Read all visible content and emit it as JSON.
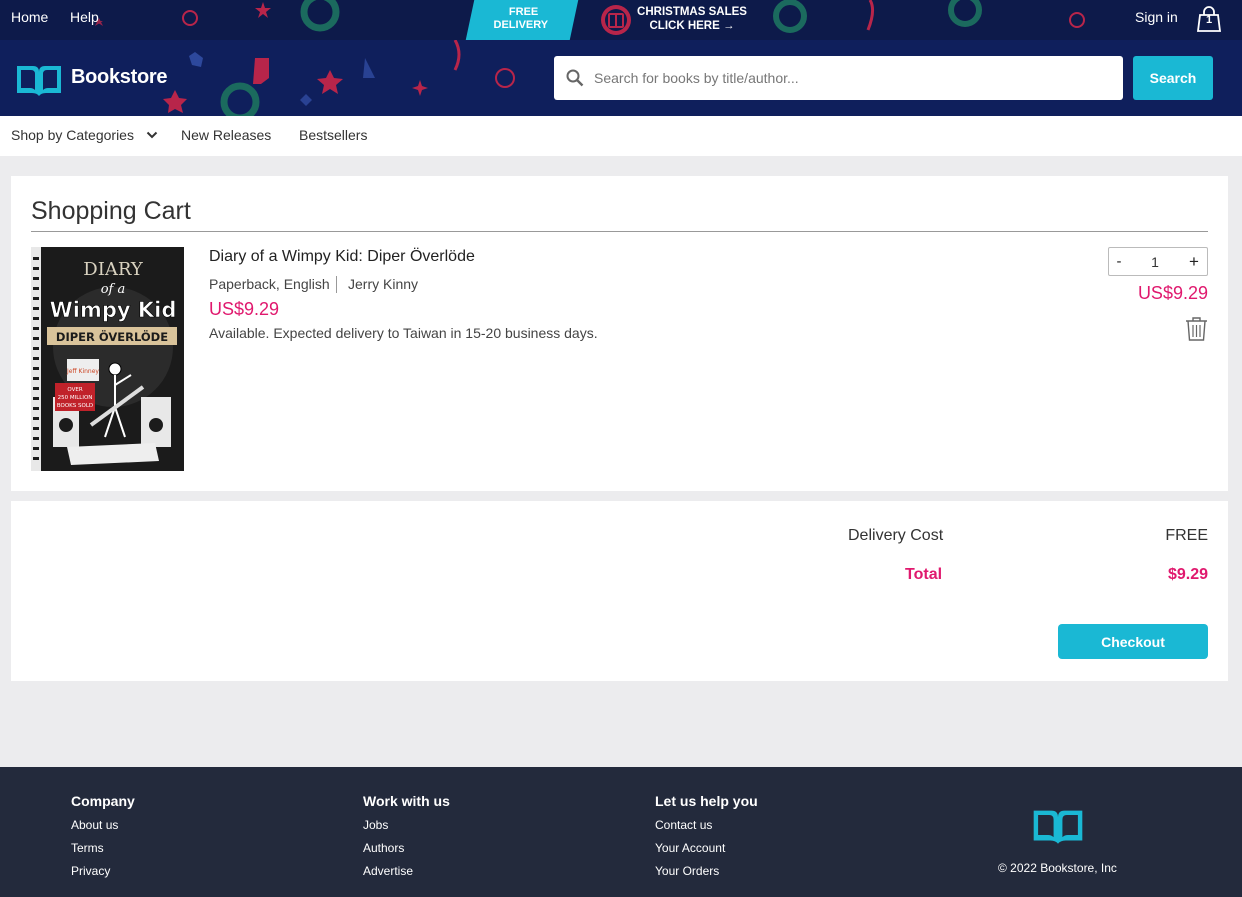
{
  "header": {
    "links": {
      "home": "Home",
      "help": "Help",
      "sign_in": "Sign in"
    },
    "promo_free": [
      "FREE",
      "DELIVERY"
    ],
    "promo_xmas": [
      "CHRISTMAS SALES",
      "CLICK HERE →"
    ],
    "cart_count": "1",
    "brand": "Bookstore",
    "search": {
      "placeholder": "Search for books by title/author...",
      "value": "",
      "button_label": "Search"
    },
    "colors": {
      "top_bar": "#0d1a4a",
      "main_bar": "#0f1f5c",
      "accent": "#1ab8d4"
    }
  },
  "nav": {
    "categories_label": "Shop by Categories",
    "new_releases_label": "New Releases",
    "bestsellers_label": "Bestsellers"
  },
  "cart": {
    "title": "Shopping Cart",
    "item": {
      "cover": {
        "title_lines": [
          "DIARY",
          "of a",
          "Wimpy Kid",
          "DIPER ÖVERLÖDE"
        ],
        "author_mark": "Jeff Kinney",
        "badge_lines": [
          "OVER",
          "250 MILLION",
          "BOOKS SOLD"
        ]
      },
      "title": "Diary of a Wimpy Kid: Diper Överlöde",
      "format": "Paperback, English",
      "author": "Jerry Kinny",
      "price": "US$9.29",
      "availability": "Available. Expected delivery to Taiwan in 15-20 business days.",
      "quantity": "1",
      "minus_label": "-",
      "plus_label": "+",
      "line_price": "US$9.29"
    },
    "price_color": "#e0196e"
  },
  "summary": {
    "delivery_label": "Delivery Cost",
    "delivery_value": "FREE",
    "total_label": "Total",
    "total_value": "$9.29",
    "checkout_label": "Checkout"
  },
  "footer": {
    "columns": [
      {
        "heading": "Company",
        "links": [
          "About us",
          "Terms",
          "Privacy"
        ]
      },
      {
        "heading": "Work with us",
        "links": [
          "Jobs",
          "Authors",
          "Advertise"
        ]
      },
      {
        "heading": "Let us help you",
        "links": [
          "Contact us",
          "Your Account",
          "Your Orders"
        ]
      }
    ],
    "copyright": "© 2022 Bookstore, Inc"
  }
}
